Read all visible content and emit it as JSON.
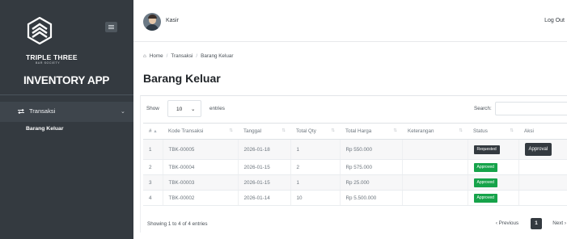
{
  "sidebar": {
    "brand_name": "TRIPLE THREE",
    "brand_sub": "BAR SOCIETY",
    "app_title": "INVENTORY APP",
    "menu": {
      "label": "Transaksi",
      "icon": "exchange-icon",
      "chevron": "⌄"
    },
    "submenu": [
      "Barang Keluar"
    ]
  },
  "topbar": {
    "user_name": "Kasir",
    "logout_label": "Log Out"
  },
  "breadcrumb": [
    "Home",
    "/",
    "Transaksi",
    "/",
    "Barang Keluar"
  ],
  "page_title": "Barang Keluar",
  "table_controls": {
    "show_label": "Show",
    "entries_value": "10",
    "entries_label": "entries",
    "search_label": "Search:",
    "search_value": ""
  },
  "table": {
    "headers": [
      "#",
      "Kode Transaksi",
      "Tanggal",
      "Total Qty",
      "Total Harga",
      "Keterangan",
      "Status",
      "Aksi"
    ],
    "rows": [
      {
        "no": "1",
        "kode": "TBK-00005",
        "tanggal": "2026-01-18",
        "qty": "1",
        "harga": "Rp 550.000",
        "ket": "",
        "status": "Requested",
        "status_type": "pending",
        "aksi": "Approval"
      },
      {
        "no": "2",
        "kode": "TBK-00004",
        "tanggal": "2026-01-15",
        "qty": "2",
        "harga": "Rp 575.000",
        "ket": "",
        "status": "Approved",
        "status_type": "approved",
        "aksi": ""
      },
      {
        "no": "3",
        "kode": "TBK-00003",
        "tanggal": "2026-01-15",
        "qty": "1",
        "harga": "Rp 25.000",
        "ket": "",
        "status": "Approved",
        "status_type": "approved",
        "aksi": ""
      },
      {
        "no": "4",
        "kode": "TBK-00002",
        "tanggal": "2026-01-14",
        "qty": "10",
        "harga": "Rp 5.500.000",
        "ket": "",
        "status": "Approved",
        "status_type": "approved",
        "aksi": ""
      }
    ]
  },
  "footer": {
    "info": "Showing 1 to 4 of 4 entries",
    "prev": "‹ Previous",
    "current_page": "1",
    "next": "Next ›"
  },
  "colors": {
    "sidebar_bg": "#343a40",
    "approved": "#16a34a",
    "pending": "#343a40"
  }
}
